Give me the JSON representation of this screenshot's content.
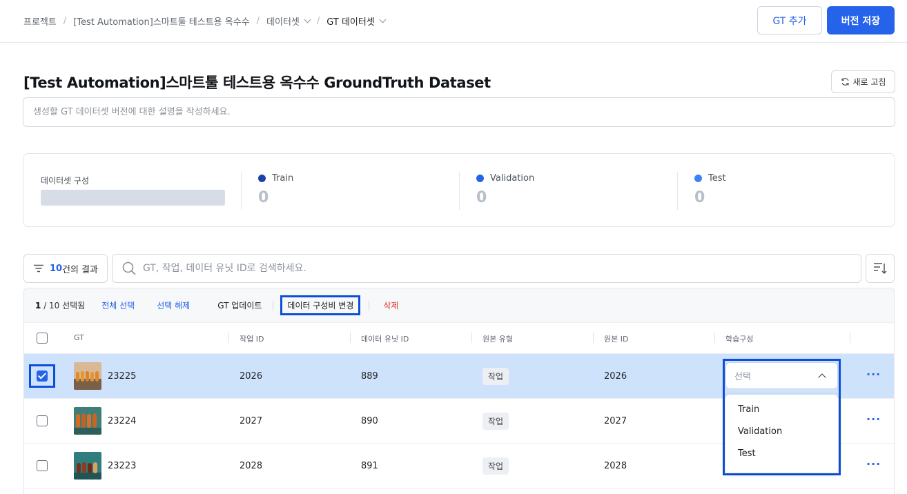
{
  "breadcrumb": [
    {
      "label": "프로젝트",
      "chevron": false
    },
    {
      "label": "[Test Automation]스마트툴 테스트용 옥수수",
      "chevron": false
    },
    {
      "label": "데이터셋",
      "chevron": true
    },
    {
      "label": "GT 데이터셋",
      "chevron": true
    }
  ],
  "breadcrumb_sep": "/",
  "header": {
    "add_gt_label": "GT 추가",
    "save_version_label": "버전 저장"
  },
  "page": {
    "title": "[Test Automation]스마트툴 테스트용 옥수수 GroundTruth Dataset",
    "refresh_label": "새로 고침",
    "description_placeholder": "생성할 GT 데이터셋 버전에 대한 설명을 작성하세요."
  },
  "stats": {
    "compose_label": "데이터셋 구성",
    "train": {
      "label": "Train",
      "value": "0",
      "color": "#1e40af"
    },
    "validation": {
      "label": "Validation",
      "value": "0",
      "color": "#2563eb"
    },
    "test": {
      "label": "Test",
      "value": "0",
      "color": "#3b82f6"
    }
  },
  "filter": {
    "count": "10",
    "suffix": "건의 결과"
  },
  "search": {
    "placeholder": "GT, 작업, 데이터 유닛 ID로 검색하세요."
  },
  "actions": {
    "selected": "1",
    "total": "/ 10 선택됨",
    "select_all": "전체 선택",
    "deselect": "선택 해제",
    "gt_update": "GT 업데이트",
    "change_ratio": "데이터 구성비 변경",
    "delete": "삭제"
  },
  "columns": [
    "GT",
    "작업 ID",
    "데이터 유닛 ID",
    "원본 유형",
    "원본 ID",
    "학습구성"
  ],
  "rows": [
    {
      "gt": "23225",
      "task_id": "2026",
      "unit_id": "889",
      "type": "작업",
      "source_id": "2026",
      "selected": true
    },
    {
      "gt": "23224",
      "task_id": "2027",
      "unit_id": "890",
      "type": "작업",
      "source_id": "2027",
      "selected": false
    },
    {
      "gt": "23223",
      "task_id": "2028",
      "unit_id": "891",
      "type": "작업",
      "source_id": "2028",
      "selected": false
    }
  ],
  "more_label": "···",
  "dropdown": {
    "placeholder": "선택",
    "options": [
      "Train",
      "Validation",
      "Test"
    ]
  },
  "colors": {
    "primary": "#2563eb",
    "highlight": "#0b4fd8",
    "selected_row": "#cfe2fb",
    "danger": "#d93025"
  }
}
